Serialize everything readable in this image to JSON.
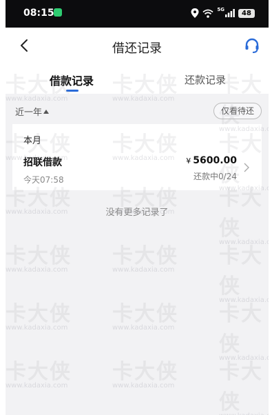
{
  "status_bar": {
    "time": "08:15",
    "battery": "48",
    "network": "5G"
  },
  "header": {
    "title": "借还记录",
    "back_icon": "chevron-left-icon",
    "service_icon": "headset-icon"
  },
  "tabs": [
    {
      "label": "借款记录",
      "active": true
    },
    {
      "label": "还款记录",
      "active": false
    }
  ],
  "filter": {
    "period": "近一年",
    "pending_only": "仅看待还"
  },
  "records": {
    "month": "本月",
    "items": [
      {
        "name": "招联借款",
        "time": "今天07:58",
        "currency": "¥",
        "amount": "5600.00",
        "status": "还款中0/24"
      }
    ]
  },
  "no_more_text": "没有更多记录了",
  "watermark": {
    "brand": "卡大侠",
    "url": "www.kadaxia.com"
  },
  "colors": {
    "accent": "#2a6bd8",
    "background": "#f2f2f4"
  }
}
